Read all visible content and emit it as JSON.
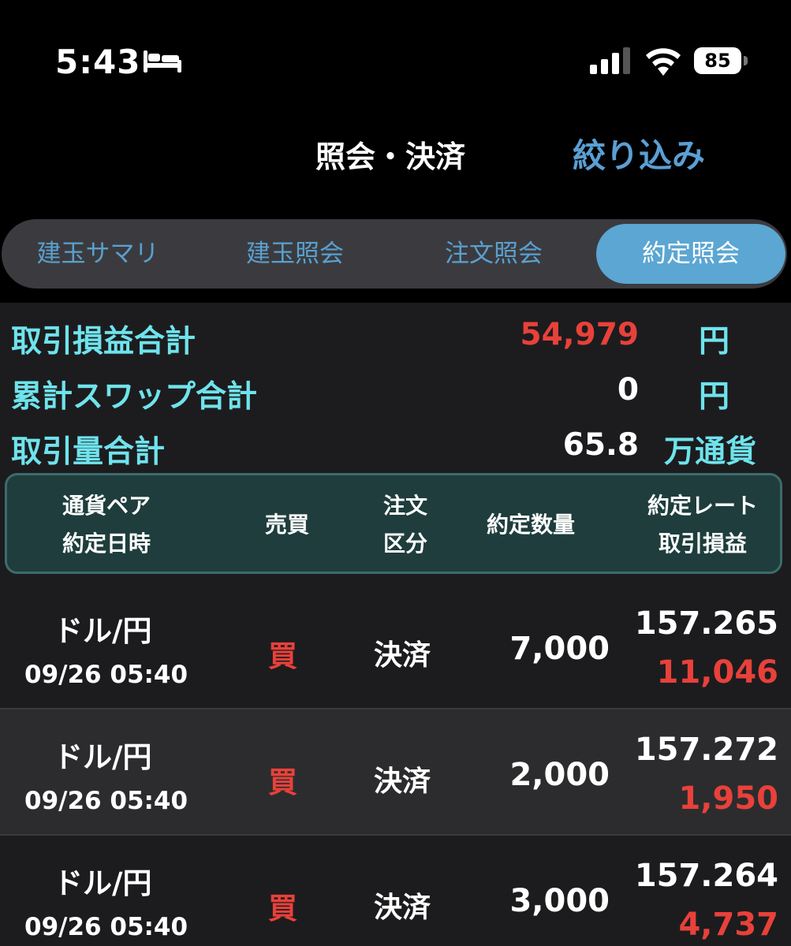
{
  "status_bar": {
    "time": "5:43",
    "battery": "85"
  },
  "header": {
    "title": "照会・決済",
    "filter_label": "絞り込み"
  },
  "tabs": [
    "建玉サマリ",
    "建玉照会",
    "注文照会",
    "約定照会"
  ],
  "active_tab": "約定照会",
  "summary": {
    "pnl_total": {
      "label": "取引損益合計",
      "value": "54,979",
      "unit": "円"
    },
    "swap_total": {
      "label": "累計スワップ合計",
      "value": "0",
      "unit": "円"
    },
    "volume_total": {
      "label": "取引量合計",
      "value": "65.8",
      "unit": "万通貨"
    }
  },
  "table": {
    "headers": {
      "pair": "通貨ペア",
      "datetime": "約定日時",
      "side": "売買",
      "order_type_1": "注文",
      "order_type_2": "区分",
      "quantity": "約定数量",
      "rate": "約定レート",
      "pnl": "取引損益"
    },
    "rows": [
      {
        "pair": "ドル/円",
        "datetime": "09/26 05:40",
        "side": "買",
        "order_type": "決済",
        "quantity": "7,000",
        "rate": "157.265",
        "pnl": "11,046"
      },
      {
        "pair": "ドル/円",
        "datetime": "09/26 05:40",
        "side": "買",
        "order_type": "決済",
        "quantity": "2,000",
        "rate": "157.272",
        "pnl": "1,950"
      },
      {
        "pair": "ドル/円",
        "datetime": "09/26 05:40",
        "side": "買",
        "order_type": "決済",
        "quantity": "3,000",
        "rate": "157.264",
        "pnl": "4,737"
      }
    ]
  },
  "colors": {
    "accent": "#5ba6d2",
    "label": "#6fe3ec",
    "loss_profit": "#e8413a",
    "header_bg": "#1f3d3d"
  }
}
